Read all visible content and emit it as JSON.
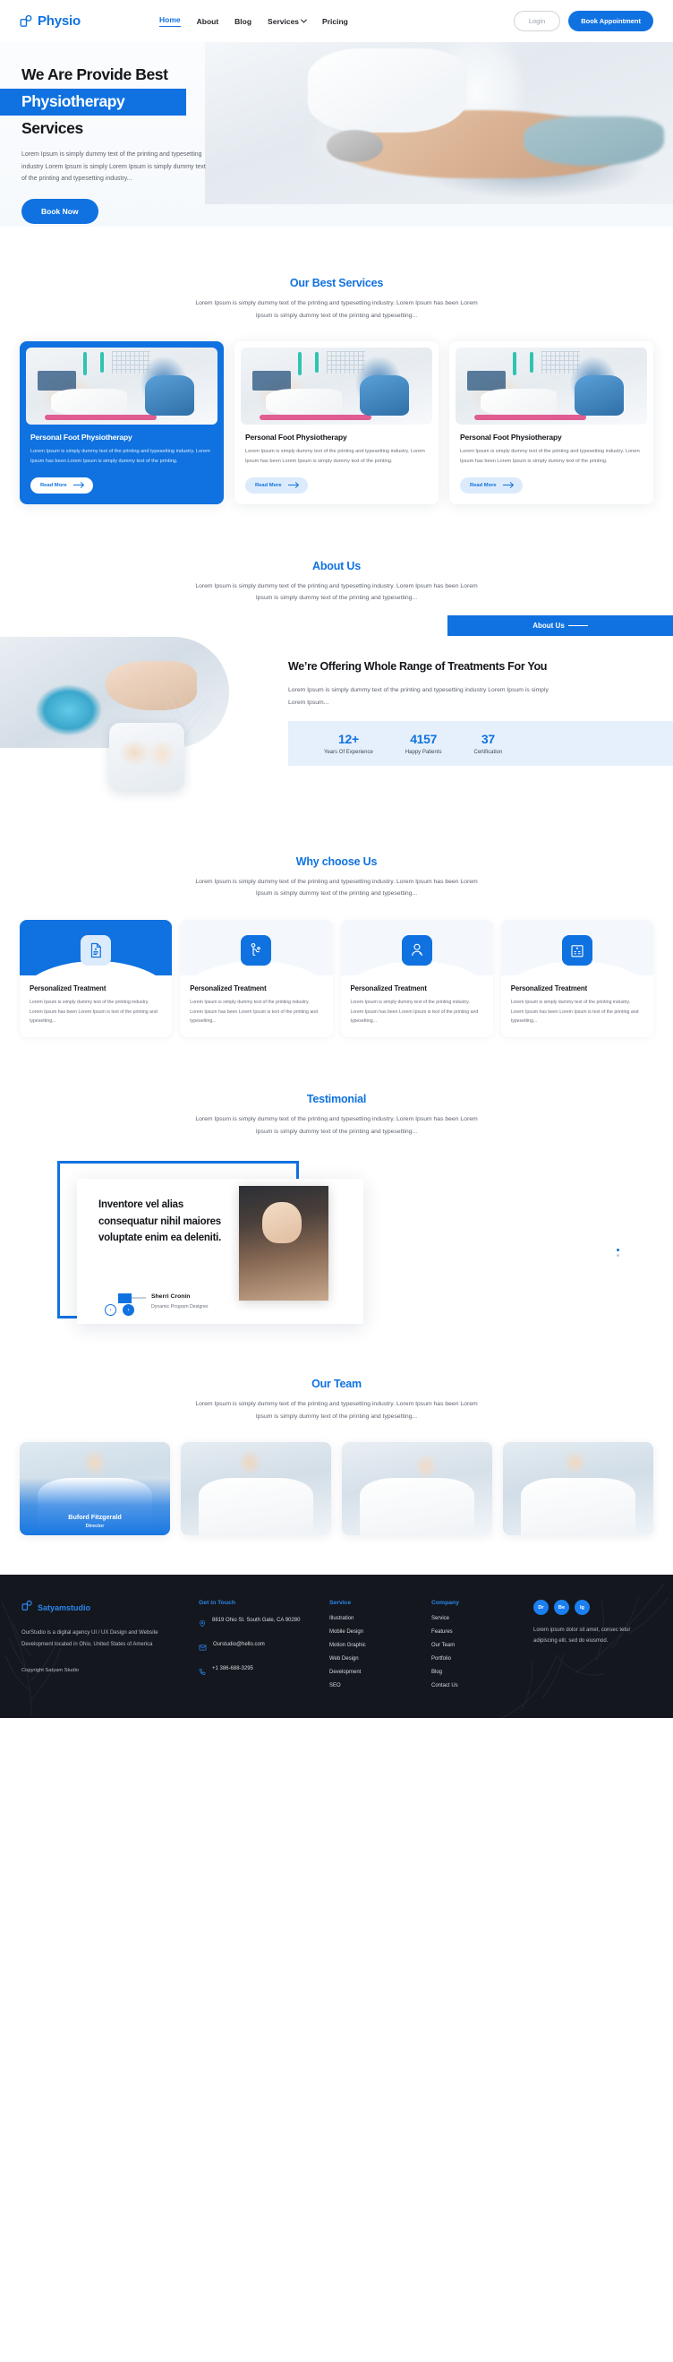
{
  "header": {
    "brand": "Physio",
    "brand_icon": "physio-logo-icon",
    "nav": [
      {
        "label": "Home",
        "active": true
      },
      {
        "label": "About",
        "active": false
      },
      {
        "label": "Blog",
        "active": false
      },
      {
        "label": "Services",
        "active": false,
        "has_dropdown": true
      },
      {
        "label": "Pricing",
        "active": false
      }
    ],
    "login_label": "Login",
    "appointment_label": "Book Appointment"
  },
  "hero": {
    "line1": "We Are Provide Best",
    "line2": "Physiotherapy",
    "line3": "Services",
    "paragraph": "Lorem Ipsum is simply dummy text of the printing and typesetting industry Lorem Ipsum is simply Lorem Ipsum is simply dummy text of the printing and typesetting industry...",
    "cta_label": "Book Now"
  },
  "services": {
    "title": "Our Best Services",
    "subtitle": "Lorem Ipsum is simply dummy text of the printing and typesetting industry. Lorem Ipsum has been Lorem Ipsum is simply dummy text of the printing and typesetting...",
    "read_more_label": "Read More",
    "cards": [
      {
        "name": "Personal Foot Physiotherapy",
        "desc": "Lorem Ipsum is simply dummy text of the printing and typesetting industry. Lorem Ipsum has been Lorem Ipsum is simply dummy text of the printing."
      },
      {
        "name": "Personal Foot Physiotherapy",
        "desc": "Lorem Ipsum is simply dummy text of the printing and typesetting industry. Lorem Ipsum has been Lorem Ipsum is simply dummy text of the printing."
      },
      {
        "name": "Personal Foot Physiotherapy",
        "desc": "Lorem Ipsum is simply dummy text of the printing and typesetting industry. Lorem Ipsum has been Lorem Ipsum is simply dummy text of the printing."
      }
    ]
  },
  "about": {
    "title": "About Us",
    "subtitle": "Lorem Ipsum is simply dummy text of the printing and typesetting industry. Lorem Ipsum has been Lorem Ipsum is simply dummy text of the printing and typesetting...",
    "tag": "About Us",
    "heading": "We’re Offering Whole Range of Treatments For You",
    "paragraph": "Lorem Ipsum is simply dummy text of the printing and typesetting industry Lorem Ipsum is simply Lorem Ipsum...",
    "stats": [
      {
        "value": "12+",
        "label": "Years Of Experience"
      },
      {
        "value": "4157",
        "label": "Happy Patients"
      },
      {
        "value": "37",
        "label": "Certification"
      }
    ]
  },
  "why": {
    "title": "Why choose Us",
    "subtitle": "Lorem Ipsum is simply dummy text of the printing and typesetting industry. Lorem Ipsum has been Lorem Ipsum is simply dummy text of the printing and typesetting...",
    "cards": [
      {
        "name": "Personalized Treatment",
        "desc": "Lorem Ipsum is simply dummy text of the printing industry. Lorem Ipsum has been Lorem Ipsum is text of the printing and typesetting...",
        "icon": "medical-document-icon",
        "featured": true
      },
      {
        "name": "Personalized Treatment",
        "desc": "Lorem Ipsum is simply dummy text of the printing industry. Lorem Ipsum has been Lorem Ipsum is text of the printing and typesetting...",
        "icon": "physiotherapy-person-icon",
        "featured": false
      },
      {
        "name": "Personalized Treatment",
        "desc": "Lorem Ipsum is simply dummy text of the printing industry. Lorem Ipsum has been Lorem Ipsum is text of the printing and typesetting...",
        "icon": "doctor-avatar-icon",
        "featured": false
      },
      {
        "name": "Personalized Treatment",
        "desc": "Lorem Ipsum is simply dummy text of the printing industry. Lorem Ipsum has been Lorem Ipsum is text of the printing and typesetting...",
        "icon": "hospital-building-icon",
        "featured": false
      }
    ]
  },
  "testimonial": {
    "title": "Testimonial",
    "subtitle": "Lorem Ipsum is simply dummy text of the printing and typesetting industry. Lorem Ipsum has been Lorem Ipsum is simply dummy text of the printing and typesetting...",
    "quote": "Inventore vel alias consequatur nihil maiores voluptate enim ea deleniti.",
    "author_name": "Sherri Cronin",
    "author_role": "Dynamic Program Designer",
    "prev_icon": "chevron-left-icon",
    "next_icon": "chevron-right-icon"
  },
  "team": {
    "title": "Our Team",
    "subtitle": "Lorem Ipsum is simply dummy text of the printing and typesetting industry. Lorem Ipsum has been Lorem Ipsum is simply dummy text of the printing and typesetting...",
    "members": [
      {
        "name": "Buford Fitzgerald",
        "role": "Director",
        "show_label": true
      },
      {
        "name": "",
        "role": "",
        "show_label": false
      },
      {
        "name": "",
        "role": "",
        "show_label": false
      },
      {
        "name": "",
        "role": "",
        "show_label": false
      }
    ]
  },
  "footer": {
    "brand": "Satyamstudio",
    "about": "OurStudio is a digital agency UI / UX Design and Website Development located in Ohio, United States of America",
    "copyright": "Copyright Satyam Studio",
    "touch": {
      "heading": "Get in Touch",
      "address": "8819 Ohio St. South Gate, CA 90280",
      "email": "Ourstudio@hello.com",
      "phone": "+1 386-688-3295",
      "location_icon": "location-pin-icon",
      "email_icon": "envelope-icon",
      "phone_icon": "phone-icon"
    },
    "service": {
      "heading": "Service",
      "links": [
        "Illustration",
        "Mobile Design",
        "Motion Graphic",
        "Web Design",
        "Development",
        "SEO"
      ]
    },
    "company": {
      "heading": "Company",
      "links": [
        "Service",
        "Features",
        "Our Team",
        "Portfolio",
        "Blog",
        "Contact Us"
      ]
    },
    "socials": [
      {
        "label": "Dr",
        "name": "dribbble-icon"
      },
      {
        "label": "Be",
        "name": "behance-icon"
      },
      {
        "label": "Ig",
        "name": "instagram-icon"
      }
    ],
    "social_text": "Lorem ipsum dolor sit amet, consec tetur adipiscing elit, sed do eiusmod."
  },
  "colors": {
    "accent": "#1072e0",
    "accent_light": "#dcebfb",
    "stats_bg": "#e6f0fc",
    "footer_bg": "#14171d",
    "text_dark": "#14161a",
    "text_muted": "#5d636c"
  }
}
